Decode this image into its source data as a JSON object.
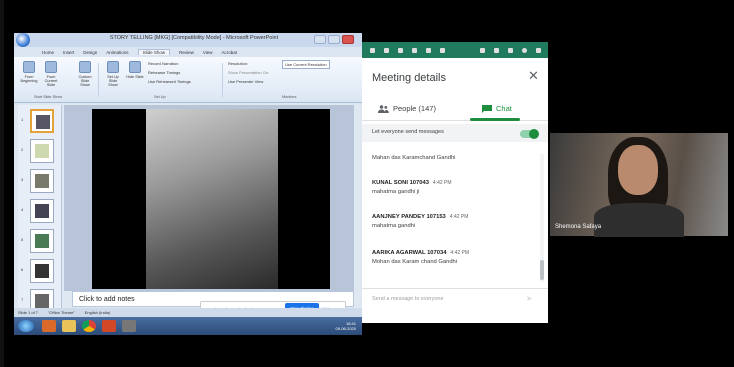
{
  "powerpoint": {
    "title": "STORY TELLING [MKG] [Compatibility Mode] - Microsoft PowerPoint",
    "tabs": [
      "Home",
      "Insert",
      "Design",
      "Animations",
      "Slide Show",
      "Review",
      "View",
      "Acrobat"
    ],
    "ribbon": {
      "from_beginning": "From Beginning",
      "from_current": "From Current Slide",
      "custom_show": "Custom Slide Show",
      "setup_show": "Set Up Slide Show",
      "hide_slide": "Hide Slide",
      "record_narration": "Record Narration",
      "rehearse_timings": "Rehearse Timings",
      "use_rehearsed": "Use Rehearsed Timings",
      "resolution_label": "Resolution:",
      "resolution_value": "Use Current Resolution",
      "show_presentation_on": "Show Presentation On:",
      "use_presenter_view": "Use Presenter View",
      "group_start": "Start Slide Show",
      "group_setup": "Set Up",
      "group_monitors": "Monitors"
    },
    "thumb_numbers": [
      "1",
      "2",
      "3",
      "4",
      "5",
      "6",
      "7"
    ],
    "notes_placeholder": "Click to add notes",
    "status_slide": "Slide 1 of 7",
    "status_theme": "\"Office Theme\"",
    "status_lang": "English (India)",
    "clock_time": "16:41",
    "clock_date": "05-06-2020"
  },
  "share_bar": {
    "text": "meet.google.com is sharing your screen.",
    "stop_label": "Stop sharing",
    "hide_label": "Hide"
  },
  "panel": {
    "title": "Meeting details",
    "close_glyph": "✕",
    "people_label": "People (147)",
    "chat_label": "Chat",
    "let_everyone": "Let everyone send messages",
    "messages": [
      {
        "sender": "",
        "time": "",
        "text": "Mahan das Karamchand Gandhi"
      },
      {
        "sender": "KUNAL SONI 107043",
        "time": "4:42 PM",
        "text": "mahatma gandhi ji"
      },
      {
        "sender": "AANJNEY PANDEY 107153",
        "time": "4:42 PM",
        "text": "mahatma gandhi"
      },
      {
        "sender": "AARIKA AGARWAL 107034",
        "time": "4:42 PM",
        "text": "Mohan das Karam chand Gandhi"
      }
    ],
    "input_placeholder": "Send a message to everyone",
    "send_glyph": "➤"
  },
  "self_view": {
    "name": "Shemona Safaya"
  },
  "colors": {
    "meet_green": "#1e8e3e",
    "stop_blue": "#1a73e8",
    "ppt_blue": "#dfe7f1"
  }
}
